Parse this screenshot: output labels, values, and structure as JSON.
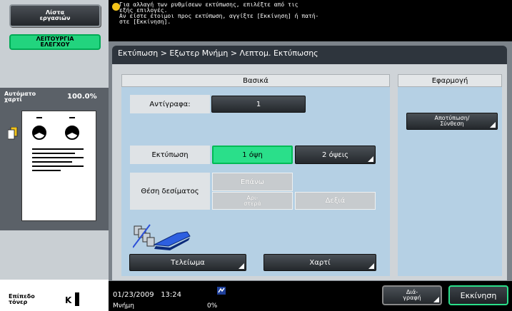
{
  "left_panel": {
    "job_list_label": "Λίστα\nεργασιών",
    "check_function_label": "ΛΕΙΤΟΥΡΓΙΑ\nΕΛΕΓΧΟΥ",
    "auto_paper_label": "Αυτόματο\nχαρτί",
    "zoom": "100.0%",
    "toner_label": "Επίπεδο\nτόνερ",
    "toner_color": "K"
  },
  "message": "Για αλλαγή των ρυθμίσεων εκτύπωσης, επιλέξτε από τις\nεξής επιλογές.\nΑν είστε έτοιμοι προς εκτύπωση, αγγίξτε [Εκκίνηση] ή πατή-\nστε [Εκκίνηση].",
  "breadcrumb": "Εκτύπωση > Εξωτερ Μνήμη > Λεπτομ. Εκτύπωσης",
  "basic": {
    "header": "Βασικά",
    "copies_label": "Αντίγραφα:",
    "copies_value": "1",
    "print_label": "Εκτύπωση",
    "one_side": "1 όψη",
    "two_sides": "2 όψεις",
    "binding_label": "Θέση δεσίματος",
    "top": "Επάνω",
    "left": "Αρι-\nστερά",
    "right": "Δεξιά",
    "finishing": "Τελείωμα",
    "paper": "Χαρτί"
  },
  "apply": {
    "header": "Εφαρμογή",
    "stamp_compose": "Αποτύπωση/\nΣύνθεση"
  },
  "status": {
    "date": "01/23/2009",
    "time": "13:24",
    "memory_label": "Μνήμη",
    "memory_value": "0%",
    "preview": "Διά-\nγραφή",
    "start": "Εκκίνηση"
  },
  "colors": {
    "accent_green": "#2adf8a",
    "panel_blue": "#b5d0e4",
    "header_dark": "#2e353d"
  }
}
